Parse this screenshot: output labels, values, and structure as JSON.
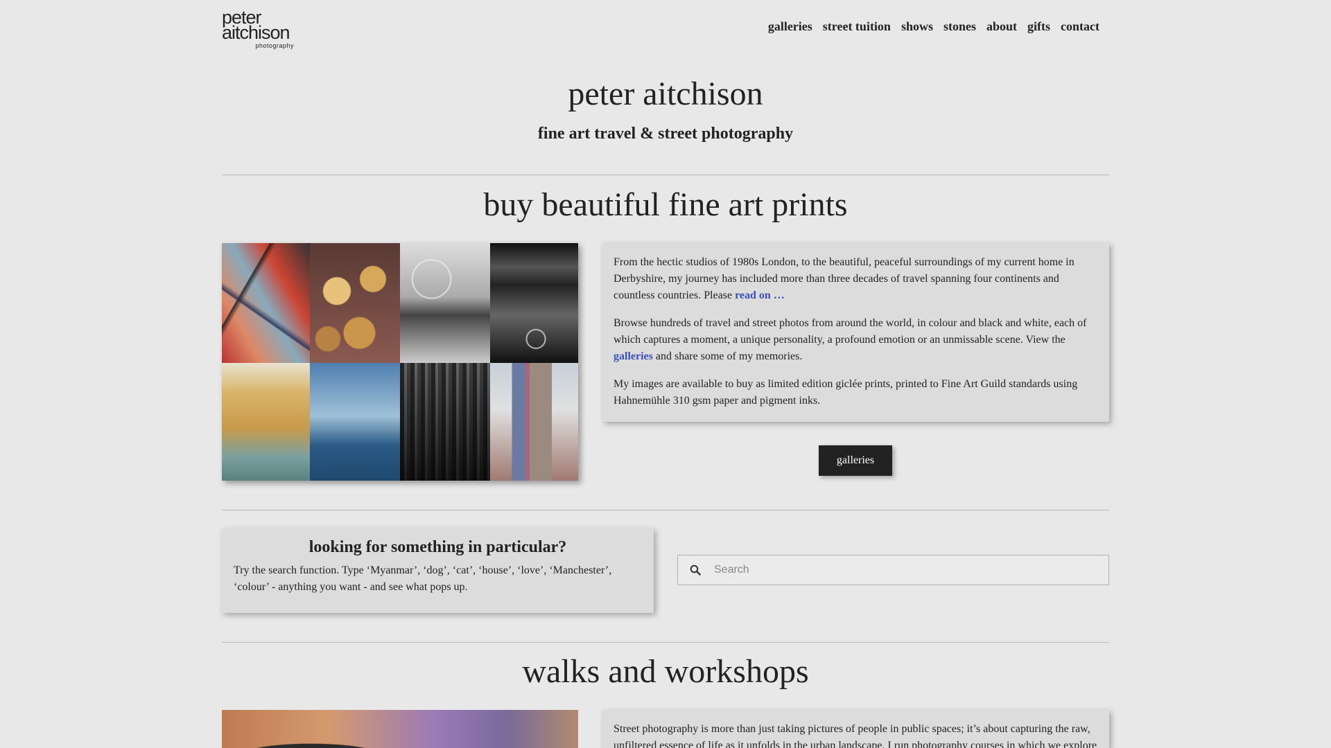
{
  "header": {
    "logo": {
      "line1": "peter",
      "line2": "aitchison",
      "line3": "photography"
    },
    "nav": [
      {
        "label": "galleries"
      },
      {
        "label": "street tuition"
      },
      {
        "label": "shows"
      },
      {
        "label": "stones"
      },
      {
        "label": "about"
      },
      {
        "label": "gifts"
      },
      {
        "label": "contact"
      }
    ]
  },
  "hero": {
    "title": "peter aitchison",
    "subtitle": "fine art travel & street photography"
  },
  "prints": {
    "heading": "buy beautiful fine art prints",
    "para1_text": "From the hectic studios of 1980s London, to the beautiful, peaceful surroundings of my current home in Derbyshire, my journey has included more than three decades of travel spanning four continents and countless countries. Please ",
    "para1_link": "read on …",
    "para2_text_before": "Browse hundreds of travel and street photos from around the world, in colour and black and white, each of which captures a moment, a unique personality, a profound emotion or an unmissable scene. View the ",
    "para2_link": "galleries",
    "para2_text_after": " and share some of my memories.",
    "para3_text": "My images are available to buy as limited edition giclée prints, printed to Fine Art Guild standards using Hahnemühle 310 gsm paper and pigment inks.",
    "button_label": "galleries"
  },
  "search": {
    "heading": "looking for something in particular?",
    "text": "Try the search function. Type ‘Myanmar’, ‘dog’, ‘cat’, ‘house’, ‘love’, ‘Manchester’, ‘colour’ - anything you want - and see what pops up.",
    "placeholder": "Search",
    "value": ""
  },
  "workshops": {
    "heading": "walks and workshops",
    "text": "Street photography is more than just taking pictures of people in public spaces; it’s about capturing the raw, unfiltered essence of life as it unfolds in the urban landscape. I run photography courses in which we explore"
  }
}
